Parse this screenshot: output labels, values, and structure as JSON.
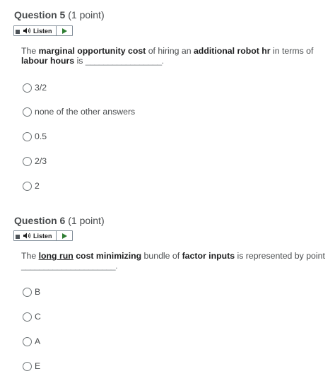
{
  "listen_label": "Listen",
  "questions": [
    {
      "title": "Question 5",
      "points": "(1 point)",
      "stem": {
        "p1": "The ",
        "b1": "marginal opportunity cost",
        "p2": " of hiring an ",
        "b2": "additional robot hr",
        "p3": " in terms of ",
        "b3": "labour hours",
        "p4": " is ",
        "blank": "_________________."
      },
      "choices": [
        "3/2",
        "none of the other answers",
        "0.5",
        "2/3",
        "2"
      ]
    },
    {
      "title": "Question 6",
      "points": "(1 point)",
      "stem": {
        "p1": "The ",
        "u1": "long run",
        "p2": " ",
        "b1": "cost minimizing",
        "p3": " bundle of ",
        "b2": "factor inputs",
        "p4": " is represented by point",
        "blank": "_____________________."
      },
      "choices": [
        "B",
        "C",
        "A",
        "E"
      ]
    }
  ]
}
